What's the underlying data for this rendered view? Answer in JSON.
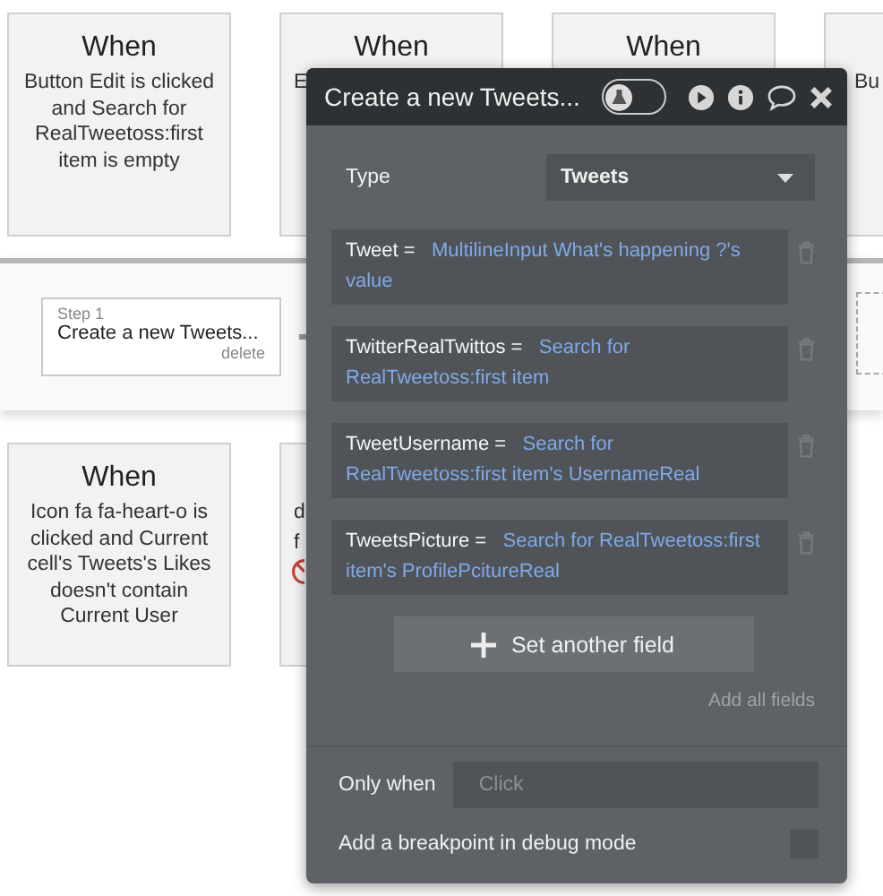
{
  "cards_top": [
    {
      "title": "When",
      "text": "Button Edit is clicked and Search for RealTweetoss:first item is empty"
    },
    {
      "title": "When",
      "text": "E"
    },
    {
      "title": "When"
    },
    {
      "text": "Bu"
    }
  ],
  "step": {
    "label": "Step 1",
    "title": "Create a new Tweets...",
    "delete": "delete"
  },
  "cards_bottom": [
    {
      "title": "When",
      "text": "Icon fa fa-heart-o is clicked and Current cell's Tweets's Likes doesn't contain Current User"
    },
    {
      "lines": [
        "d",
        "f"
      ],
      "disabled": true
    }
  ],
  "panel": {
    "title": "Create a new Tweets...",
    "debug_on": false,
    "type_label": "Type",
    "type_value": "Tweets",
    "fields": [
      {
        "name": "Tweet",
        "operator": "=",
        "value": "MultilineInput What's happening ?'s value"
      },
      {
        "name": "TwitterRealTwittos",
        "operator": "=",
        "value": "Search for RealTweetoss:first item"
      },
      {
        "name": "TweetUsername",
        "operator": "=",
        "value": "Search for RealTweetoss:first item's UsernameReal"
      },
      {
        "name": "TweetsPicture",
        "operator": "=",
        "value": "Search for RealTweetoss:first item's ProfilePcitureReal"
      }
    ],
    "add_button": "Set another field",
    "add_all": "Add all fields",
    "only_when_label": "Only when",
    "only_when_placeholder": "Click",
    "breakpoint_label": "Add a breakpoint in debug mode",
    "breakpoint_checked": false
  }
}
